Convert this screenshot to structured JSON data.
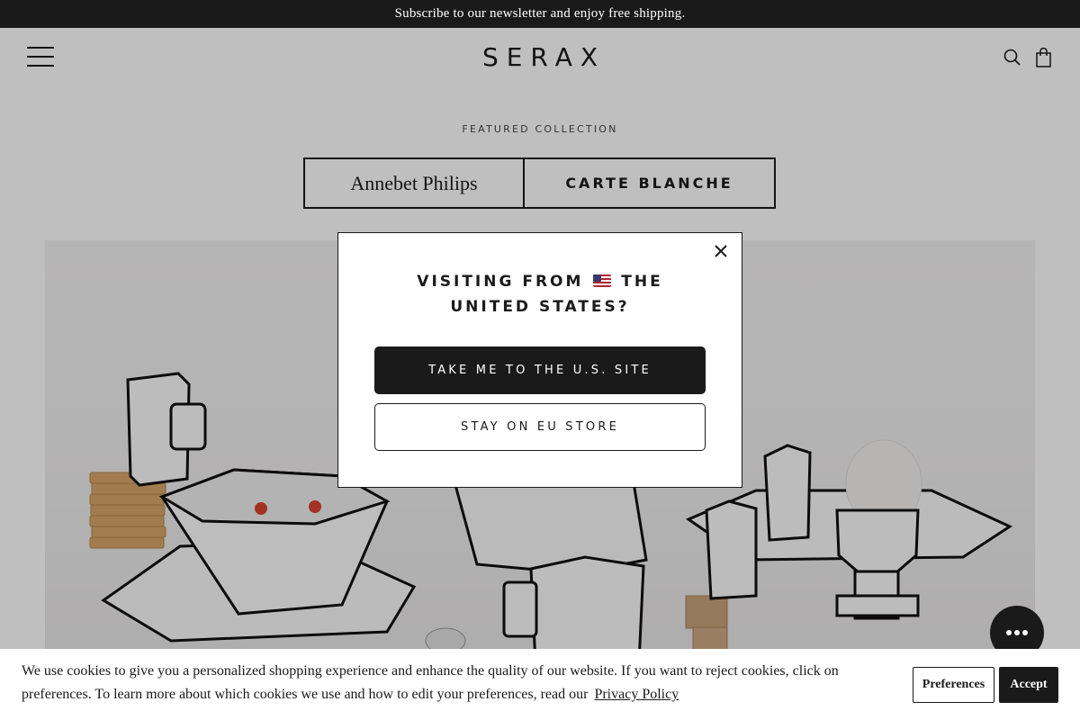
{
  "announcement": {
    "text": "Subscribe to our newsletter and enjoy free shipping."
  },
  "header": {
    "logo": "SERAX",
    "menu_icon": "hamburger-menu-icon",
    "search_icon": "search-icon",
    "cart_icon": "shopping-bag-icon"
  },
  "featured": {
    "label": "FEATURED COLLECTION",
    "designer": "Annebet Philips",
    "collection": "CARTE BLANCHE"
  },
  "hero": {
    "image": "tableware-photo"
  },
  "modal": {
    "title_prefix": "VISITING FROM",
    "flag_icon": "us-flag-icon",
    "title_country": "THE UNITED STATES?",
    "primary_button": "TAKE ME TO THE U.S. SITE",
    "secondary_button": "STAY ON EU STORE",
    "close_icon": "close-icon"
  },
  "chat": {
    "icon": "chat-icon"
  },
  "cookie": {
    "text": "We use cookies to give you a personalized shopping experience and enhance the quality of our website. If you want to reject cookies, click on preferences. To learn more about which cookies we use and how to edit your preferences, read our",
    "link": "Privacy Policy",
    "preferences_button": "Preferences",
    "accept_button": "Accept"
  },
  "colors": {
    "dark": "#1a1a1a",
    "overlay": "rgba(0,0,0,0.25)",
    "background": "#ffffff"
  }
}
